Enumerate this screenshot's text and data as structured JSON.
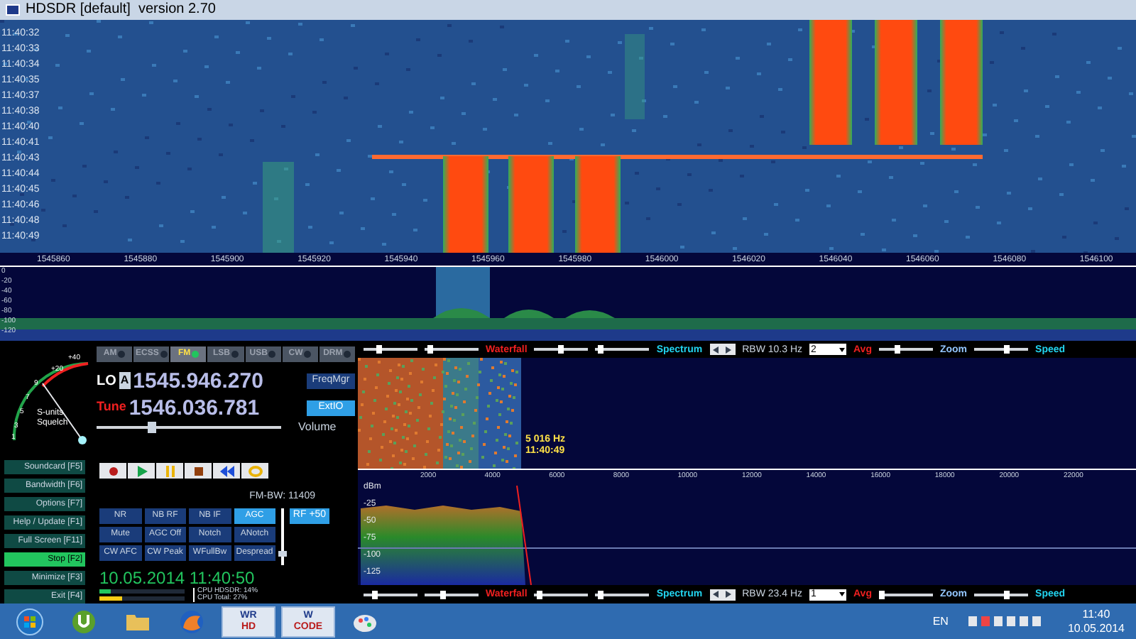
{
  "window": {
    "title": "HDSDR [default]  version 2.70"
  },
  "waterfall": {
    "times": [
      "11:40:32",
      "11:40:33",
      "11:40:34",
      "11:40:35",
      "11:40:37",
      "11:40:38",
      "11:40:40",
      "11:40:41",
      "11:40:43",
      "11:40:44",
      "11:40:45",
      "11:40:46",
      "11:40:48",
      "11:40:49"
    ]
  },
  "frequency_axis": {
    "labels": [
      "1545860",
      "1545880",
      "1545900",
      "1545920",
      "1545940",
      "1545960",
      "1545980",
      "1546000",
      "1546020",
      "1546040",
      "1546060",
      "1546080",
      "1546100"
    ]
  },
  "spectrum": {
    "scale": [
      "0",
      "-20",
      "-40",
      "-60",
      "-80",
      "-100",
      "-120"
    ]
  },
  "s_meter": {
    "scale": [
      "+40",
      "+20",
      "9",
      "7",
      "5",
      "3",
      "1"
    ],
    "labels": [
      "S-units",
      "Squelch"
    ]
  },
  "modes": [
    {
      "label": "AM",
      "selected": false
    },
    {
      "label": "ECSS",
      "selected": false
    },
    {
      "label": "FM",
      "selected": true
    },
    {
      "label": "LSB",
      "selected": false
    },
    {
      "label": "USB",
      "selected": false
    },
    {
      "label": "CW",
      "selected": false
    },
    {
      "label": "DRM",
      "selected": false
    }
  ],
  "lo": {
    "label": "LO",
    "vfo": "A",
    "frequency": "1545.946.270"
  },
  "tune": {
    "label": "Tune",
    "frequency": "1546.036.781"
  },
  "freq_buttons": [
    {
      "label": "FreqMgr",
      "on": false
    },
    {
      "label": "ExtIO",
      "on": true
    }
  ],
  "volume": {
    "label": "Volume",
    "level": 0.3
  },
  "function_keys": [
    {
      "label": "Soundcard  [F5]",
      "selected": false
    },
    {
      "label": "Bandwidth  [F6]",
      "selected": false
    },
    {
      "label": "Options  [F7]",
      "selected": false
    },
    {
      "label": "Help / Update  [F1]",
      "selected": false
    },
    {
      "label": "Full Screen  [F11]",
      "selected": false
    },
    {
      "label": "Stop  [F2]",
      "selected": true
    },
    {
      "label": "Minimize  [F3]",
      "selected": false
    },
    {
      "label": "Exit  [F4]",
      "selected": false
    }
  ],
  "transport": [
    {
      "kind": "record"
    },
    {
      "kind": "play"
    },
    {
      "kind": "pause"
    },
    {
      "kind": "stop"
    },
    {
      "kind": "rewind"
    },
    {
      "kind": "loop"
    }
  ],
  "fm_bw": "FM-BW: 11409",
  "dsp_buttons": [
    {
      "label": "NR",
      "on": false
    },
    {
      "label": "NB RF",
      "on": false
    },
    {
      "label": "NB IF",
      "on": false
    },
    {
      "label": "AGC",
      "on": true
    },
    {
      "label": "Mute",
      "on": false
    },
    {
      "label": "AGC Off",
      "on": false
    },
    {
      "label": "Notch",
      "on": false
    },
    {
      "label": "ANotch",
      "on": false
    },
    {
      "label": "CW AFC",
      "on": false
    },
    {
      "label": "CW Peak",
      "on": false
    },
    {
      "label": "WFullBw",
      "on": false
    },
    {
      "label": "Despread",
      "on": false
    }
  ],
  "agc_slider": {
    "level": 0.2
  },
  "rf_button": {
    "label": "RF +50",
    "on": true
  },
  "datetime": "10.05.2014 11:40:50",
  "cpu": [
    {
      "label": "CPU HDSDR: 14%",
      "level": 0.14,
      "color": "#22c55e"
    },
    {
      "label": "CPU Total: 27%",
      "level": 0.27,
      "color": "#facc15"
    }
  ],
  "audio_waterfall": {
    "readout": [
      "5 016 Hz",
      "11:40:49"
    ]
  },
  "audio_axis": {
    "labels": [
      "2000",
      "4000",
      "6000",
      "8000",
      "10000",
      "12000",
      "14000",
      "16000",
      "18000",
      "20000",
      "22000"
    ]
  },
  "audio_spectrum": {
    "scale": [
      "dBm",
      "-25",
      "-50",
      "-75",
      "-100",
      "-125"
    ]
  },
  "control_rows": [
    [
      {
        "kind": "slider",
        "level": 0.3
      },
      {
        "kind": "slider",
        "level": 0.1
      },
      {
        "kind": "label",
        "text": "Waterfall",
        "color": "#ef2020"
      },
      {
        "kind": "slider",
        "level": 0.5
      },
      {
        "kind": "slider",
        "level": 0.1
      },
      {
        "kind": "label",
        "text": "Spectrum",
        "color": "#22d3ee"
      },
      {
        "kind": "stepper"
      },
      {
        "kind": "text",
        "text": "RBW 10.3 Hz"
      },
      {
        "kind": "dropdown",
        "text": "2"
      },
      {
        "kind": "label",
        "text": "Avg",
        "color": "#ef2020"
      },
      {
        "kind": "slider",
        "level": 0.35
      },
      {
        "kind": "label",
        "text": "Zoom",
        "color": "#93c5fd"
      },
      {
        "kind": "slider",
        "level": 0.6
      },
      {
        "kind": "label",
        "text": "Speed",
        "color": "#22d3ee"
      }
    ],
    [
      {
        "kind": "slider",
        "level": 0.2
      },
      {
        "kind": "slider",
        "level": 0.35
      },
      {
        "kind": "label",
        "text": "Waterfall",
        "color": "#ef2020"
      },
      {
        "kind": "slider",
        "level": 0.1
      },
      {
        "kind": "slider",
        "level": 0.1
      },
      {
        "kind": "label",
        "text": "Spectrum",
        "color": "#22d3ee"
      },
      {
        "kind": "stepper"
      },
      {
        "kind": "text",
        "text": "RBW 23.4 Hz"
      },
      {
        "kind": "dropdown",
        "text": "1"
      },
      {
        "kind": "label",
        "text": "Avg",
        "color": "#ef2020"
      },
      {
        "kind": "slider",
        "level": 0.05
      },
      {
        "kind": "label",
        "text": "Zoom",
        "color": "#93c5fd"
      },
      {
        "kind": "slider",
        "level": 0.6
      },
      {
        "kind": "label",
        "text": "Speed",
        "color": "#22d3ee"
      }
    ]
  ],
  "taskbar": {
    "apps": [
      {
        "kind": "start"
      },
      {
        "kind": "torrent"
      },
      {
        "kind": "folder"
      },
      {
        "kind": "browser"
      },
      {
        "kind": "badge",
        "lines": [
          "WR",
          "HD"
        ]
      },
      {
        "kind": "badge",
        "lines": [
          "W",
          "CODE"
        ]
      },
      {
        "kind": "paint"
      }
    ],
    "language": "EN",
    "time": "11:40",
    "date": "10.05.2014"
  }
}
